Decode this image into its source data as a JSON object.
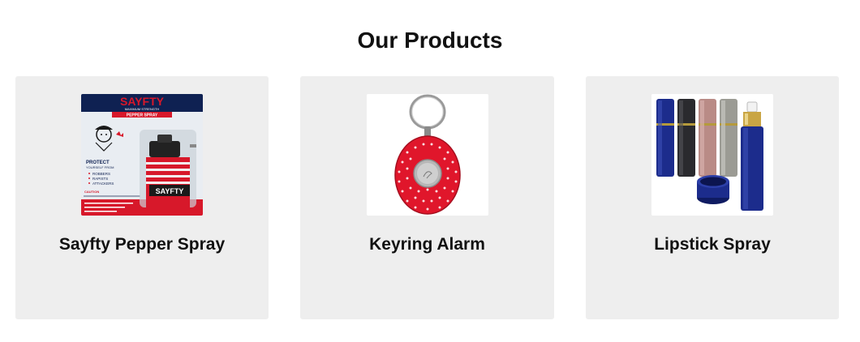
{
  "section": {
    "title": "Our Products"
  },
  "products": [
    {
      "name": "Sayfty Pepper Spray",
      "image": {
        "brand": "SAYFTY",
        "subtitle": "MAXIMUM STRENGTH",
        "banner": "PEPPER SPRAY",
        "protect": "PROTECT",
        "from": "YOURSELF FROM",
        "list": [
          "ROBBERS",
          "RAPISTS",
          "ATTACKERS"
        ],
        "caution": "CAUTION",
        "can_label": "SAYFTY"
      }
    },
    {
      "name": "Keyring Alarm"
    },
    {
      "name": "Lipstick Spray"
    }
  ],
  "colors": {
    "card_bg": "#eeeeee",
    "brand_red": "#d7182a",
    "alarm_red": "#e0162b",
    "lipstick_blue": "#1c2c8c"
  }
}
